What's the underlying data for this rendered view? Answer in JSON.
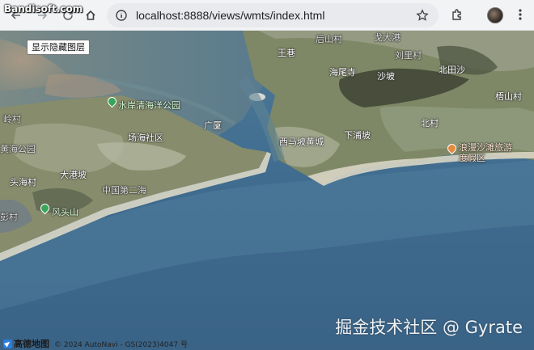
{
  "browser": {
    "url": "localhost:8888/views/wmts/index.html",
    "watermark_top": "Bandisoft.com",
    "icons": [
      "back-icon",
      "forward-icon",
      "reload-icon",
      "home-icon",
      "site-info-icon",
      "star-icon",
      "extensions-icon",
      "profile-avatar",
      "menu-icon"
    ]
  },
  "map": {
    "toggle_button": "显示隐藏图层",
    "labels": {
      "l01": "后山村",
      "l02": "戈大港",
      "l03": "王巷",
      "l04": "刘里村",
      "l05": "海尾寺",
      "l06": "沙坡",
      "l07": "北田沙",
      "l08": "梧山村",
      "l09": "水岸清海洋公园",
      "l10": "岭村",
      "l11": "广厦",
      "l12": "场海社区",
      "l13": "西马坡黄城",
      "l14": "下浦坡",
      "l15": "北村",
      "l16": "浪漫沙滩旅游度假区",
      "l17": "黄海公园",
      "l18": "大港坡",
      "l19": "头海村",
      "l20": "中国第二海",
      "l21": "风头山",
      "l22": "彭村"
    },
    "watermark": "掘金技术社区 @ Gyrate",
    "attribution": {
      "logo": "高德地图",
      "text": "© 2024 AutoNavi - GS(2023)4047 号"
    },
    "colors": {
      "sea": "#3e6a8f",
      "land": "#7f8a68",
      "poi_green": "#37a659",
      "poi_orange": "#e68a3c"
    }
  }
}
